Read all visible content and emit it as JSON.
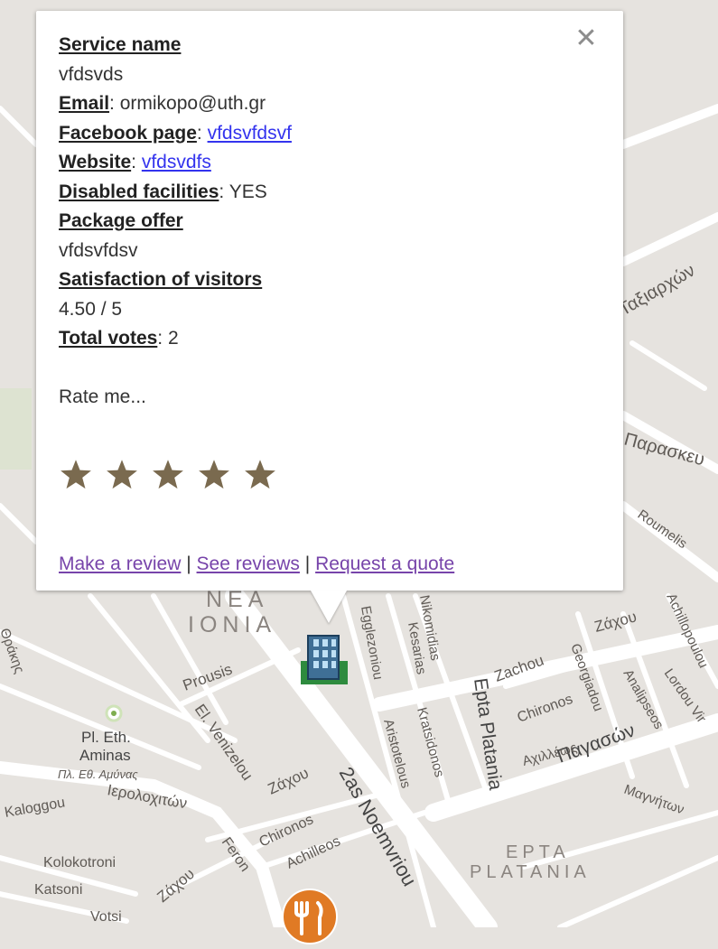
{
  "info_window": {
    "service_name_label": "Service name",
    "service_name": "vfdsvds",
    "email_label": "Email",
    "email": "ormikopo@uth.gr",
    "facebook_label": "Facebook page",
    "facebook": "vfdsvfdsvf",
    "website_label": "Website",
    "website": "vfdsvdfs",
    "disabled_label": "Disabled facilities",
    "disabled": "YES",
    "package_label": "Package offer",
    "package": "vfdsvfdsv",
    "satisfaction_label": "Satisfaction of visitors",
    "satisfaction": "4.50 / 5",
    "votes_label": "Total votes",
    "votes": "2",
    "rate_prompt": "Rate me...",
    "star_count": 5,
    "star_color": "#7a6a4f",
    "close_icon": "close-icon",
    "links": {
      "make_review": "Make a review",
      "see_reviews": "See reviews",
      "request_quote": "Request a quote",
      "separator": "|"
    }
  },
  "map": {
    "colors": {
      "land": "#e6e3df",
      "road": "#ffffff",
      "label": "#5f5a55",
      "park": "#d3e3c4"
    },
    "labels": {
      "nea": "NEA",
      "ionia": "IONIA",
      "epta1": "EPTA",
      "epta2": "PLATANIA",
      "prousis": "Prousis",
      "el_venizelou": "El. Venizelou",
      "zachou_gr": "Ζάχου",
      "zachou_gr2": "Ζάχου",
      "zachou_gr3": "Ζάχου",
      "zachou": "Zachou",
      "noemvriou": "2as Noemvriou",
      "epta_platania": "Epta Platania",
      "pagasson": "Παγασών",
      "chironos": "Chironos",
      "chironos2": "Chironos",
      "achilleos": "Achilleos",
      "feron": "Feron",
      "ierolochiton": "Ιερολοχιτών",
      "kolokotroni": "Kolokotroni",
      "katsoni": "Katsoni",
      "votsi": "Votsi",
      "kaloggou": "Kaloggou",
      "pl_eth": "Pl. Eth.",
      "aminas": "Aminas",
      "aminas_gr": "Πλ. Εθ. Αμύνας",
      "aristotelous": "Aristotelous",
      "kratsidonos": "Kratsidonos",
      "egglezoniou": "Egglezoniou",
      "kesarias": "Kesarias",
      "nikomidias": "Nikomidias",
      "roumelis": "Roumelis",
      "paraskeu": "Παρασκευ",
      "taxiarchon": "Ταξιαρχών",
      "thrakis": "Θράκης",
      "georgiadou": "Georgiadou",
      "analipseos": "Analipseos",
      "achillopoulou": "Achillopoulou",
      "magniton": "Μαγνήτων",
      "achilleos_gr": "Αχιλλέως",
      "lordou": "Lordou Vir"
    }
  }
}
